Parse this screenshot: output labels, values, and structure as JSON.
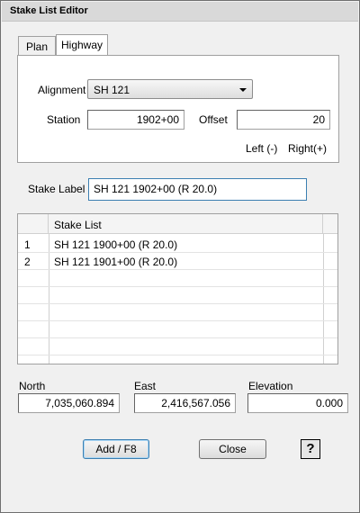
{
  "window": {
    "title": "Stake List Editor"
  },
  "tabs": [
    {
      "label": "Plan",
      "active": false
    },
    {
      "label": "Highway",
      "active": true
    }
  ],
  "highway": {
    "alignment_label": "Alignment",
    "alignment_value": "SH 121",
    "station_label": "Station",
    "station_value": "1902+00",
    "offset_label": "Offset",
    "offset_value": "20",
    "left_hint": "Left (-)",
    "right_hint": "Right(+)"
  },
  "stake_label": {
    "label": "Stake Label",
    "value": "SH 121 1902+00 (R 20.0)"
  },
  "stake_list": {
    "header": "Stake List",
    "rows": [
      {
        "num": "1",
        "text": "SH 121 1900+00 (R 20.0)"
      },
      {
        "num": "2",
        "text": "SH 121 1901+00 (R 20.0)"
      }
    ]
  },
  "coords": {
    "north_label": "North",
    "north_value": "7,035,060.894",
    "east_label": "East",
    "east_value": "2,416,567.056",
    "elevation_label": "Elevation",
    "elevation_value": "0.000"
  },
  "buttons": {
    "add": "Add  / F8",
    "close": "Close",
    "help": "?"
  },
  "icons": {
    "help": "question-mark-icon",
    "dropdown": "chevron-down-icon"
  }
}
